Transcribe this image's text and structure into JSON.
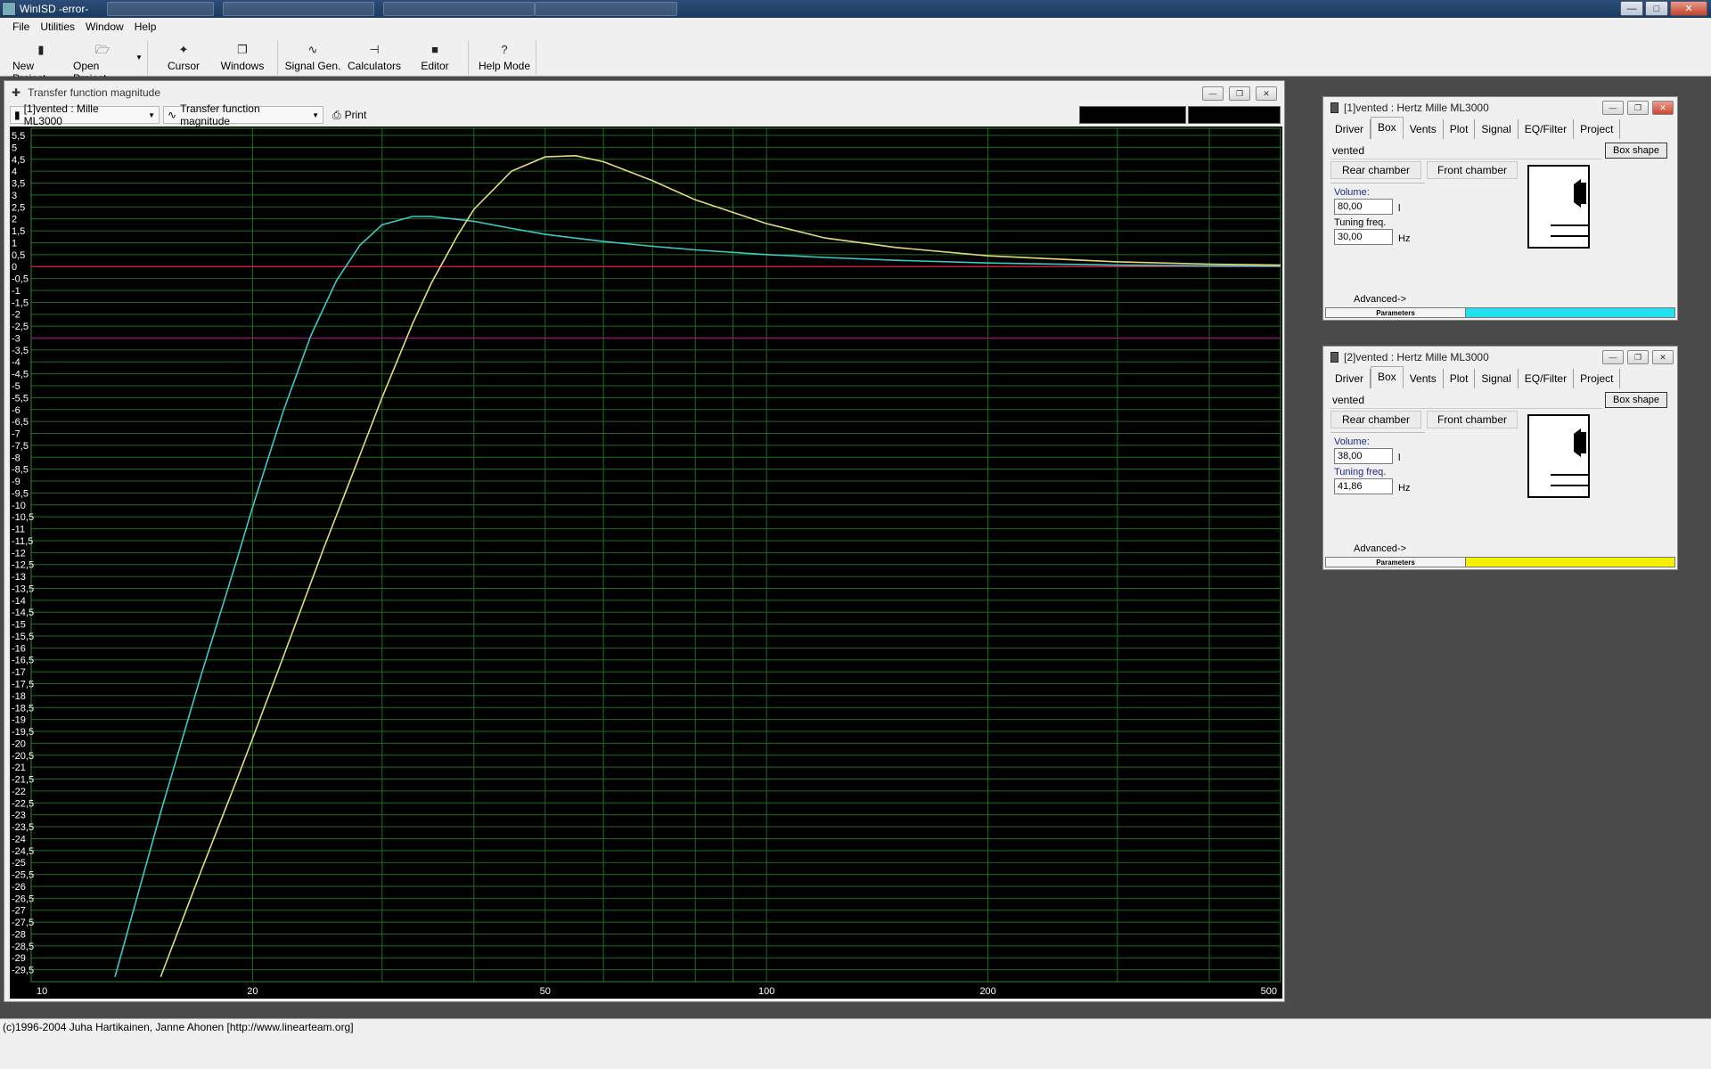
{
  "window": {
    "title": "WinISD -error-",
    "title_icon": "winisd-icon"
  },
  "menu": {
    "items": [
      "File",
      "Utilities",
      "Window",
      "Help"
    ]
  },
  "toolbar": {
    "new_project": "New Project",
    "open_project": "Open Project",
    "cursor": "Cursor",
    "windows": "Windows",
    "signal_gen": "Signal Gen.",
    "calculators": "Calculators",
    "editor": "Editor",
    "help_mode": "Help Mode"
  },
  "graph": {
    "title": "Transfer function magnitude",
    "project_combo": "[1]vented : Mille ML3000",
    "graph_combo": "Transfer function magnitude",
    "print": "Print",
    "y_ticks": [
      "5,5",
      "5",
      "4,5",
      "4",
      "3,5",
      "3",
      "2,5",
      "2",
      "1,5",
      "1",
      "0,5",
      "0",
      "-0,5",
      "-1",
      "-1,5",
      "-2",
      "-2,5",
      "-3",
      "-3,5",
      "-4",
      "-4,5",
      "-5",
      "-5,5",
      "-6",
      "-6,5",
      "-7",
      "-7,5",
      "-8",
      "-8,5",
      "-9",
      "-9,5",
      "-10",
      "-10,5",
      "-11",
      "-11,5",
      "-12",
      "-12,5",
      "-13",
      "-13,5",
      "-14",
      "-14,5",
      "-15",
      "-15,5",
      "-16",
      "-16,5",
      "-17",
      "-17,5",
      "-18",
      "-18,5",
      "-19",
      "-19,5",
      "-20",
      "-20,5",
      "-21",
      "-21,5",
      "-22",
      "-22,5",
      "-23",
      "-23,5",
      "-24",
      "-24,5",
      "-25",
      "-25,5",
      "-26",
      "-26,5",
      "-27",
      "-27,5",
      "-28",
      "-28,5",
      "-29",
      "-29,5"
    ],
    "x_ticks": [
      "10",
      "20",
      "50",
      "100",
      "200",
      "500"
    ]
  },
  "chart_data": {
    "type": "line",
    "title": "Transfer function magnitude",
    "xlabel": "",
    "ylabel": "",
    "x_scale": "log",
    "xlim": [
      10,
      500
    ],
    "ylim": [
      -30,
      5.8
    ],
    "grid": true,
    "reference_lines": [
      {
        "y": 0,
        "color": "#c0203a"
      },
      {
        "y": -3,
        "color": "#8a1a6a"
      }
    ],
    "series": [
      {
        "color": "#3ec8c8",
        "x": [
          13,
          15,
          17,
          19,
          20,
          22,
          24,
          26,
          28,
          30,
          33,
          35,
          40,
          45,
          50,
          60,
          70,
          80,
          100,
          120,
          150,
          200,
          300,
          400,
          500
        ],
        "y": [
          -29.8,
          -22.9,
          -17.2,
          -12.4,
          -10.1,
          -6.1,
          -2.9,
          -0.6,
          0.9,
          1.75,
          2.1,
          2.1,
          1.9,
          1.6,
          1.35,
          1.05,
          0.85,
          0.7,
          0.5,
          0.38,
          0.26,
          0.15,
          0.06,
          0.03,
          0.02
        ]
      },
      {
        "color": "#e3dc7a",
        "x": [
          15,
          17,
          19,
          20,
          22,
          25,
          28,
          30,
          33,
          35,
          38,
          40,
          45,
          50,
          55,
          60,
          70,
          80,
          100,
          120,
          150,
          200,
          300,
          400,
          500
        ],
        "y": [
          -29.8,
          -25.4,
          -21.6,
          -19.8,
          -16.4,
          -11.8,
          -7.9,
          -5.5,
          -2.4,
          -0.7,
          1.3,
          2.4,
          4.0,
          4.6,
          4.65,
          4.4,
          3.6,
          2.8,
          1.8,
          1.2,
          0.8,
          0.45,
          0.2,
          0.1,
          0.06
        ]
      }
    ]
  },
  "props": [
    {
      "title": "[1]vented : Hertz Mille ML3000",
      "tabs": [
        "Driver",
        "Box",
        "Vents",
        "Plot",
        "Signal",
        "EQ/Filter",
        "Project"
      ],
      "shape": "vented",
      "box_shape": "Box shape",
      "rear": "Rear chamber",
      "front": "Front chamber",
      "volume_label": "Volume:",
      "volume": "80,00",
      "volume_unit": "l",
      "tuning_label": "Tuning freq.",
      "tuning": "30,00",
      "tuning_unit": "Hz",
      "advanced": "Advanced->",
      "params": "Parameters",
      "color": "#22e0ee"
    },
    {
      "title": "[2]vented : Hertz Mille ML3000",
      "tabs": [
        "Driver",
        "Box",
        "Vents",
        "Plot",
        "Signal",
        "EQ/Filter",
        "Project"
      ],
      "shape": "vented",
      "box_shape": "Box shape",
      "rear": "Rear chamber",
      "front": "Front chamber",
      "volume_label": "Volume:",
      "volume": "38,00",
      "volume_unit": "l",
      "tuning_label": "Tuning freq.",
      "tuning": "41,86",
      "tuning_unit": "Hz",
      "advanced": "Advanced->",
      "params": "Parameters",
      "color": "#f4f000"
    }
  ],
  "status": {
    "text": "(c)1996-2004 Juha Hartikainen, Janne Ahonen [http://www.linearteam.org]"
  }
}
